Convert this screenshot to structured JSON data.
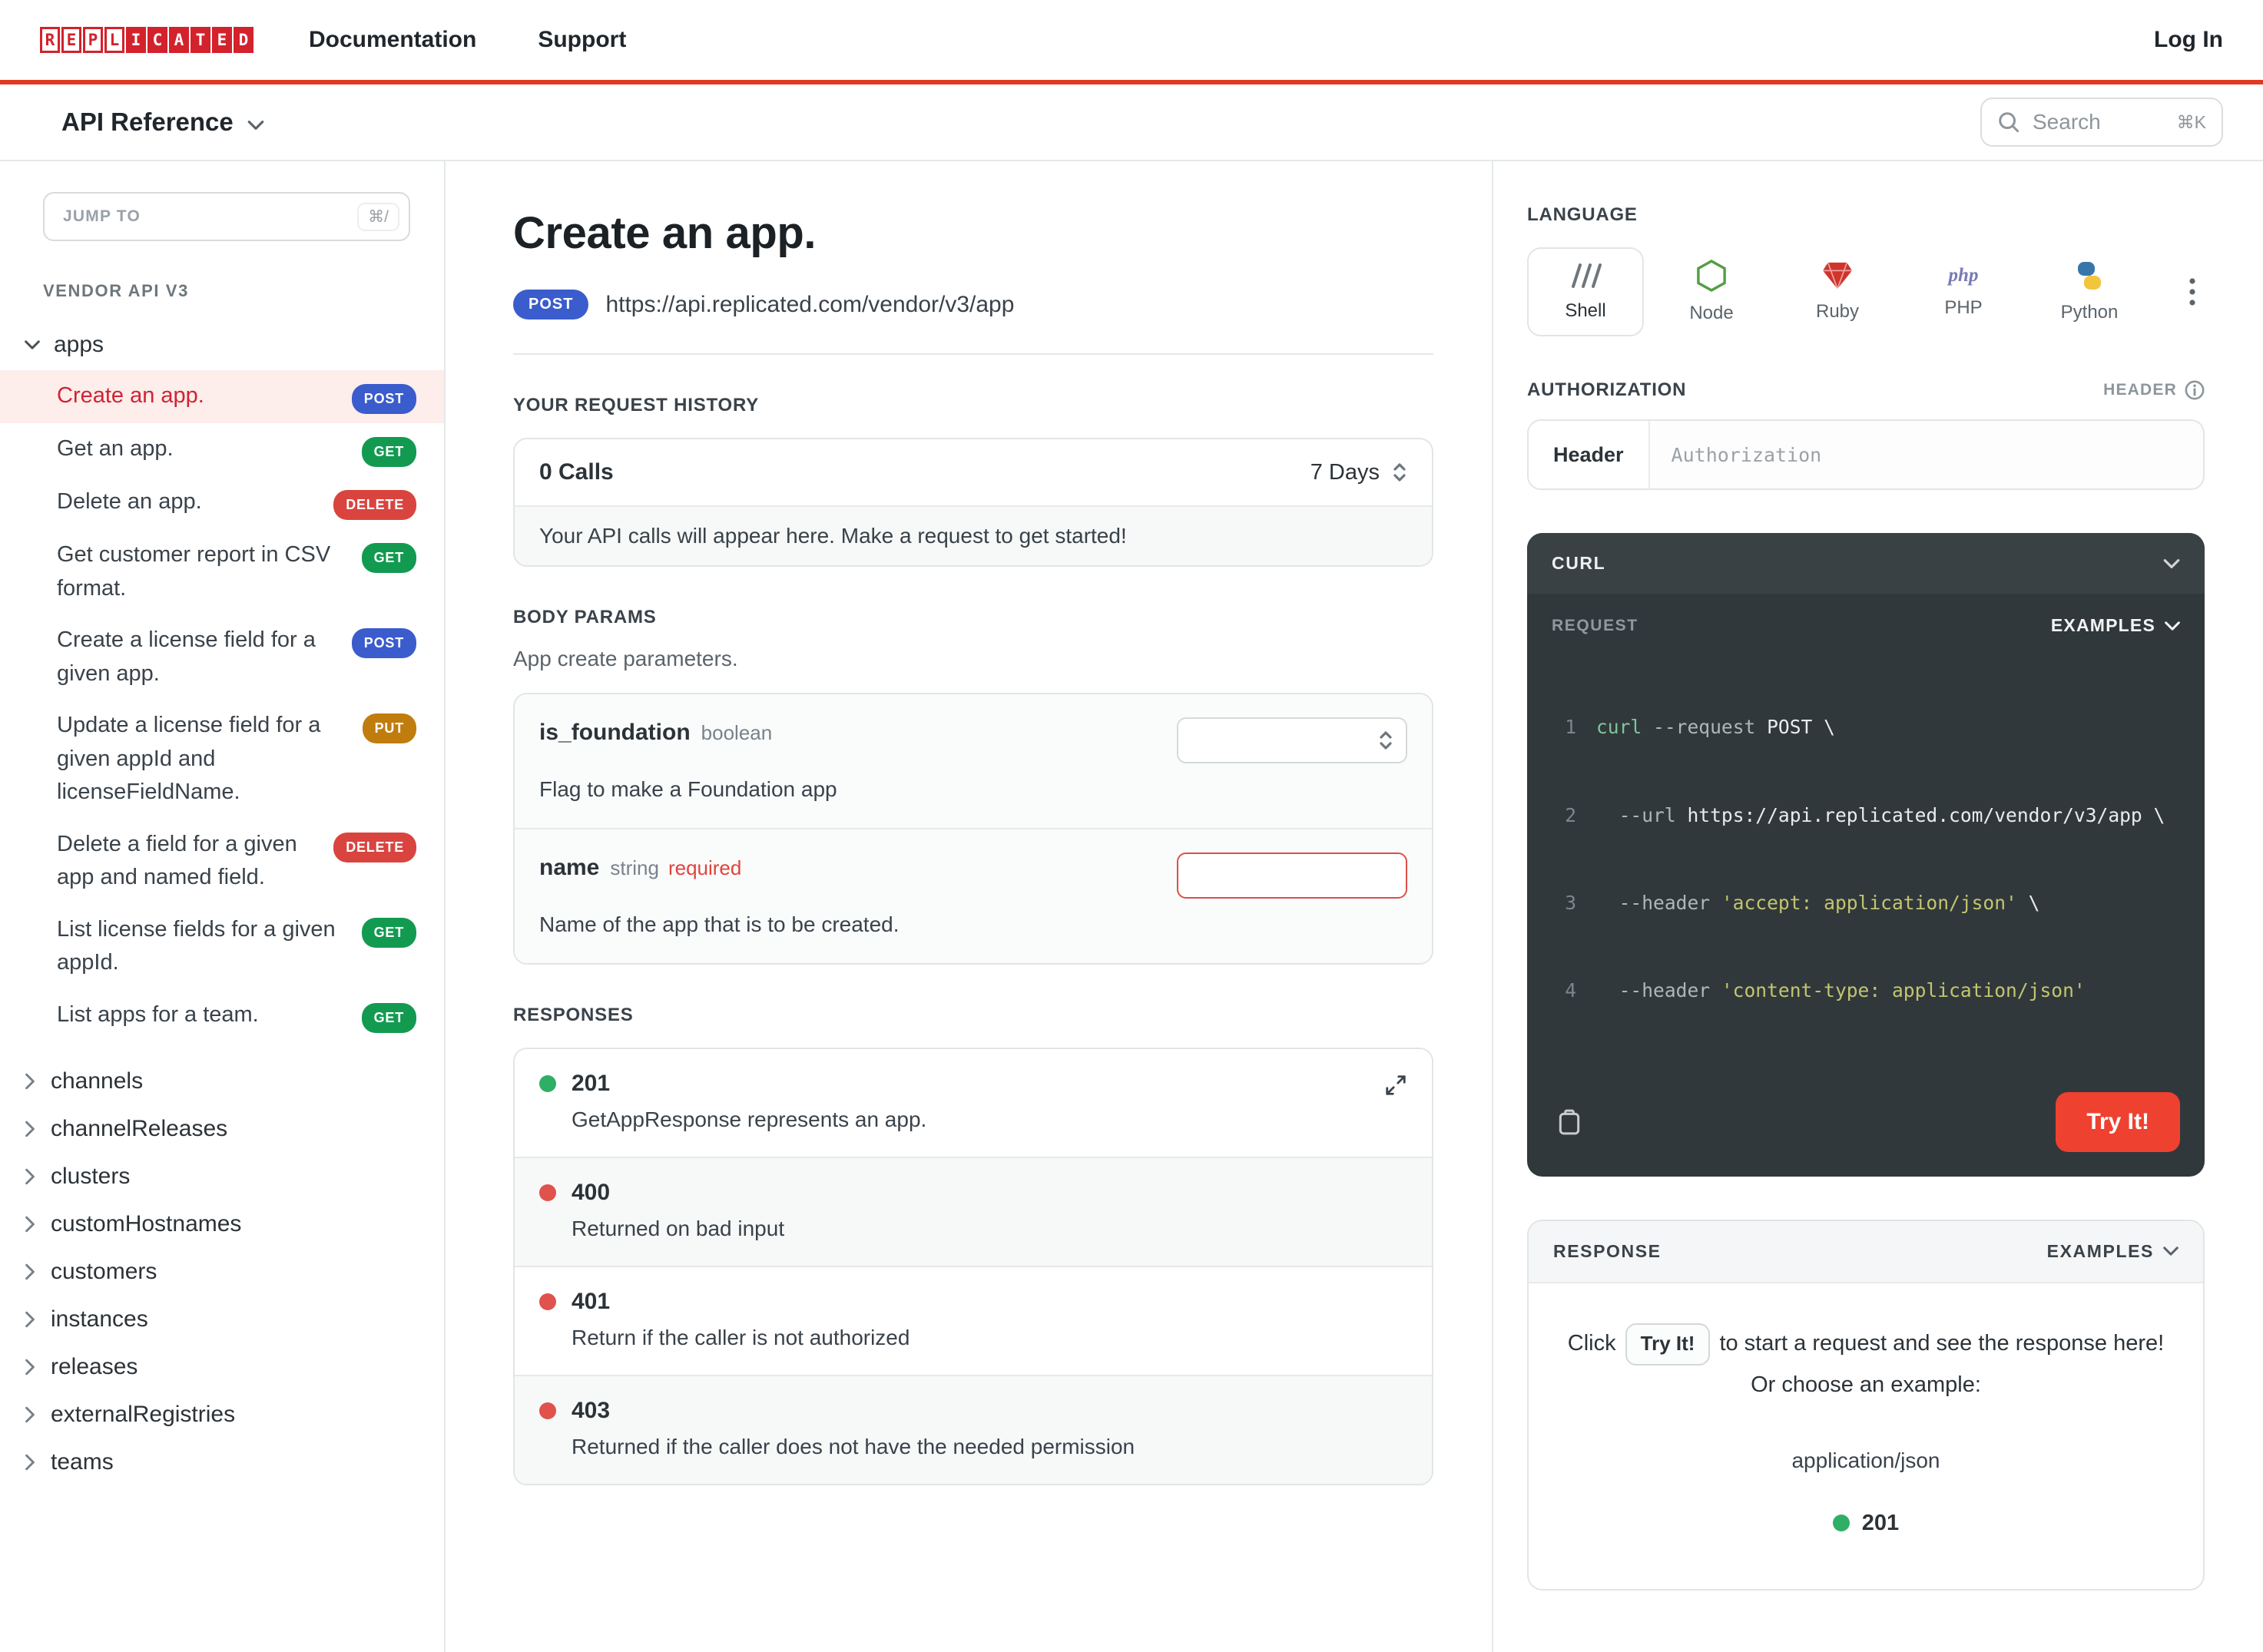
{
  "header": {
    "logo_text": "REPLICATED",
    "nav": {
      "documentation": "Documentation",
      "support": "Support"
    },
    "login_label": "Log In"
  },
  "subheader": {
    "title": "API Reference",
    "search_placeholder": "Search",
    "search_shortcut": "⌘K"
  },
  "sidebar": {
    "jump_to_label": "JUMP TO",
    "jump_to_shortcut": "⌘/",
    "section_title": "VENDOR API V3",
    "group_label": "apps",
    "endpoints": [
      {
        "label": "Create an app.",
        "method": "POST"
      },
      {
        "label": "Get an app.",
        "method": "GET"
      },
      {
        "label": "Delete an app.",
        "method": "DELETE"
      },
      {
        "label": "Get customer report in CSV format.",
        "method": "GET"
      },
      {
        "label": "Create a license field for a given app.",
        "method": "POST"
      },
      {
        "label": "Update a license field for a given appId and licenseFieldName.",
        "method": "PUT"
      },
      {
        "label": "Delete a field for a given app and named field.",
        "method": "DELETE"
      },
      {
        "label": "List license fields for a given appId.",
        "method": "GET"
      },
      {
        "label": "List apps for a team.",
        "method": "GET"
      }
    ],
    "collapsed_groups": [
      "channels",
      "channelReleases",
      "clusters",
      "customHostnames",
      "customers",
      "instances",
      "releases",
      "externalRegistries",
      "teams"
    ]
  },
  "main": {
    "title": "Create an app.",
    "method": "POST",
    "url": "https://api.replicated.com/vendor/v3/app",
    "request_history": {
      "heading": "YOUR REQUEST HISTORY",
      "calls": "0 Calls",
      "range": "7 Days",
      "empty_message": "Your API calls will appear here. Make a request to get started!"
    },
    "body_params": {
      "heading": "BODY PARAMS",
      "description": "App create parameters.",
      "params": [
        {
          "name": "is_foundation",
          "type": "boolean",
          "required": "",
          "description": "Flag to make a Foundation app"
        },
        {
          "name": "name",
          "type": "string",
          "required": "required",
          "description": "Name of the app that is to be created."
        }
      ]
    },
    "responses": {
      "heading": "RESPONSES",
      "items": [
        {
          "code": "201",
          "description": "GetAppResponse represents an app."
        },
        {
          "code": "400",
          "description": "Returned on bad input"
        },
        {
          "code": "401",
          "description": "Return if the caller is not authorized"
        },
        {
          "code": "403",
          "description": "Returned if the caller does not have the needed permission"
        }
      ]
    }
  },
  "right": {
    "language": {
      "heading": "LANGUAGE",
      "options": [
        {
          "label": "Shell"
        },
        {
          "label": "Node"
        },
        {
          "label": "Ruby"
        },
        {
          "label": "PHP"
        },
        {
          "label": "Python"
        }
      ]
    },
    "authorization": {
      "heading": "AUTHORIZATION",
      "header_tag": "HEADER",
      "field_label": "Header",
      "placeholder": "Authorization"
    },
    "curl_panel": {
      "title": "CURL",
      "request_label": "REQUEST",
      "examples_label": "EXAMPLES",
      "try_it_label": "Try It!",
      "code_lines": [
        {
          "num": "1",
          "parts": [
            {
              "text": "curl "
            },
            {
              "text": "--request "
            },
            {
              "text": "POST \\"
            }
          ]
        },
        {
          "num": "2",
          "parts": [
            {
              "text": "  --url "
            },
            {
              "text": "https://api.replicated.com/vendor/v3/app \\"
            }
          ]
        },
        {
          "num": "3",
          "parts": [
            {
              "text": "  --header "
            },
            {
              "text": "'accept: application/json'"
            },
            {
              "text": " \\"
            }
          ]
        },
        {
          "num": "4",
          "parts": [
            {
              "text": "  --header "
            },
            {
              "text": "'content-type: application/json'"
            }
          ]
        }
      ]
    },
    "response_panel": {
      "title": "RESPONSE",
      "examples_label": "EXAMPLES",
      "hint_prefix": "Click",
      "hint_button": "Try It!",
      "hint_suffix": "to start a request and see the response here! Or choose an example:",
      "example_type": "application/json",
      "example_code": "201",
      "colors": {
        "success": "#2fae66",
        "error": "#e0524c",
        "accent": "#ee4130",
        "brand": "#d3222c"
      }
    }
  }
}
